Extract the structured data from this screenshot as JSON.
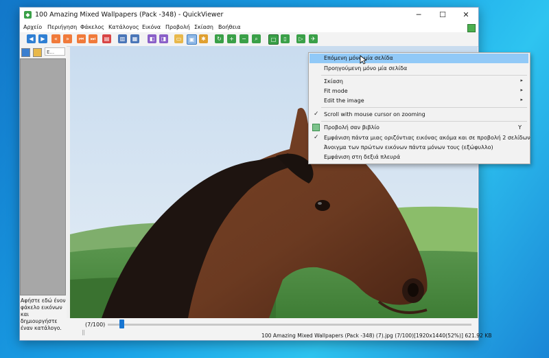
{
  "window": {
    "title": "100 Amazing Mixed Wallpapers (Pack -348) - QuickViewer",
    "minimize": "─",
    "maximize": "☐",
    "close": "✕"
  },
  "menubar": [
    "Αρχείο",
    "Περιήγηση",
    "Φάκελος",
    "Κατάλογος",
    "Εικόνα",
    "Προβολή",
    "Σκίαση",
    "Βοήθεια"
  ],
  "sidebar": {
    "combo": "E...",
    "hint": "Αφήστε εδώ ένον φάκελο εικόνων και δημιουργήστε έναν κατάλογο."
  },
  "viewer": {
    "zoom_percent": 52
  },
  "bottom": {
    "page_counter": "(7/100)",
    "slider_progress": 0.07,
    "status": "100 Amazing Mixed Wallpapers (Pack -348) (7).jpg (7/100)[1920x1440(52%)] 621.92 KB"
  },
  "context_menu": {
    "items": [
      {
        "label": "Επόμενη μόνο μία σελίδα",
        "highlighted": true
      },
      {
        "label": "Προηγούμενη μόνο μία σελίδα"
      },
      {
        "label": "Σκίαση",
        "submenu": "▸"
      },
      {
        "label": "Fit mode",
        "submenu": "▸"
      },
      {
        "label": "Edit the image",
        "submenu": "▸"
      },
      {
        "label": "Scroll with mouse cursor on zooming",
        "check": "✓"
      },
      {
        "label": "Προβολή σαν βιβλίο",
        "shortcut": "Y"
      },
      {
        "label": "Εμφάνιση πάντα μιας οριζόντιας εικόνας ακόμα και σε προβολή 2 σελίδων",
        "check": "✓"
      },
      {
        "label": "Άνοιγμα των πρώτων εικόνων πάντα μόνων τους (εξώφυλλο)"
      },
      {
        "label": "Εμφάνιση στη δεξιά πλευρά"
      }
    ]
  },
  "colors": {
    "accent": "#1976d2",
    "highlight": "#91c9f7",
    "sky": "#cfe1f2",
    "horse_brown": "#6b3a21"
  }
}
